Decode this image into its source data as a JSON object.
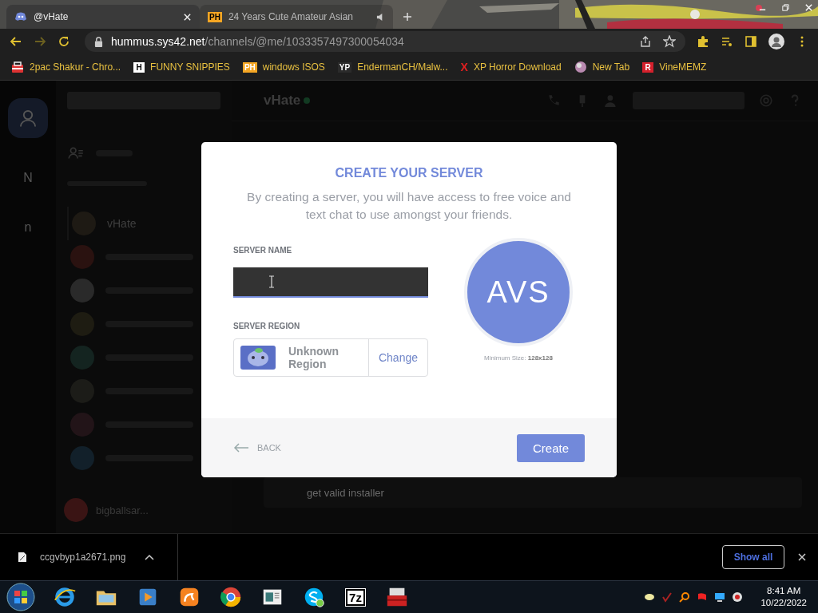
{
  "browser": {
    "tabs": [
      {
        "title": "@vHate",
        "selected": true,
        "kind": "discord",
        "audio": false
      },
      {
        "title": "24 Years Cute Amateur Asian",
        "selected": false,
        "kind": "badge",
        "badge": "PH",
        "audio": true
      }
    ],
    "url": {
      "host": "hummus.sys42.net",
      "path": "/channels/@me/1033357497300054034"
    },
    "bookmarks": [
      {
        "label": "2pac Shakur - Chro...",
        "kind": "bag"
      },
      {
        "label": "FUNNY SNIPPIES",
        "kind": "letter",
        "badge": "H",
        "color": "#ffffff"
      },
      {
        "label": "windows ISOS",
        "kind": "letter",
        "badge": "PH",
        "color": "#f5a623"
      },
      {
        "label": "EndermanCH/Malw...",
        "kind": "letter",
        "badge": "YP",
        "color": "#2b2b2b"
      },
      {
        "label": "XP Horror Download",
        "kind": "mark",
        "badge": "X",
        "color": "#e02020"
      },
      {
        "label": "New Tab",
        "kind": "globe"
      },
      {
        "label": "VineMEMZ",
        "kind": "letter",
        "badge": "R",
        "color": "#d4202c"
      }
    ]
  },
  "discord": {
    "rail": [
      {
        "label": "N"
      },
      {
        "label": "n"
      }
    ],
    "dm_list": [
      {
        "name": "vHate",
        "selected": true
      },
      {
        "selected": false
      },
      {
        "selected": false
      },
      {
        "selected": false
      },
      {
        "selected": false
      },
      {
        "selected": false
      },
      {
        "selected": false
      },
      {
        "selected": false
      }
    ],
    "user": {
      "name": "bigballsar..."
    },
    "chat_header": {
      "name": "vHate"
    },
    "message_box": {
      "value": "get valid installer"
    }
  },
  "modal": {
    "title": "CREATE YOUR SERVER",
    "description": "By creating a server, you will have access to free voice and text chat to use amongst your friends.",
    "server_name_label": "SERVER NAME",
    "server_region_label": "SERVER REGION",
    "region": "Unknown Region",
    "change": "Change",
    "icon_initials": "AVS",
    "minimum_size": "Minimum Size: **128x128**",
    "back": "BACK",
    "create": "Create"
  },
  "downloads": {
    "file": "ccgvbyp1a2671.png",
    "show_all": "Show all"
  },
  "taskbar": {
    "apps": [
      {
        "kind": "ie"
      },
      {
        "kind": "folder"
      },
      {
        "kind": "media"
      },
      {
        "kind": "uc"
      },
      {
        "kind": "chrome"
      },
      {
        "kind": "window"
      },
      {
        "kind": "skype"
      },
      {
        "kind": "label",
        "label": "7z"
      },
      {
        "kind": "toolbox"
      }
    ],
    "time": "8:41 AM",
    "date": "10/22/2022"
  }
}
